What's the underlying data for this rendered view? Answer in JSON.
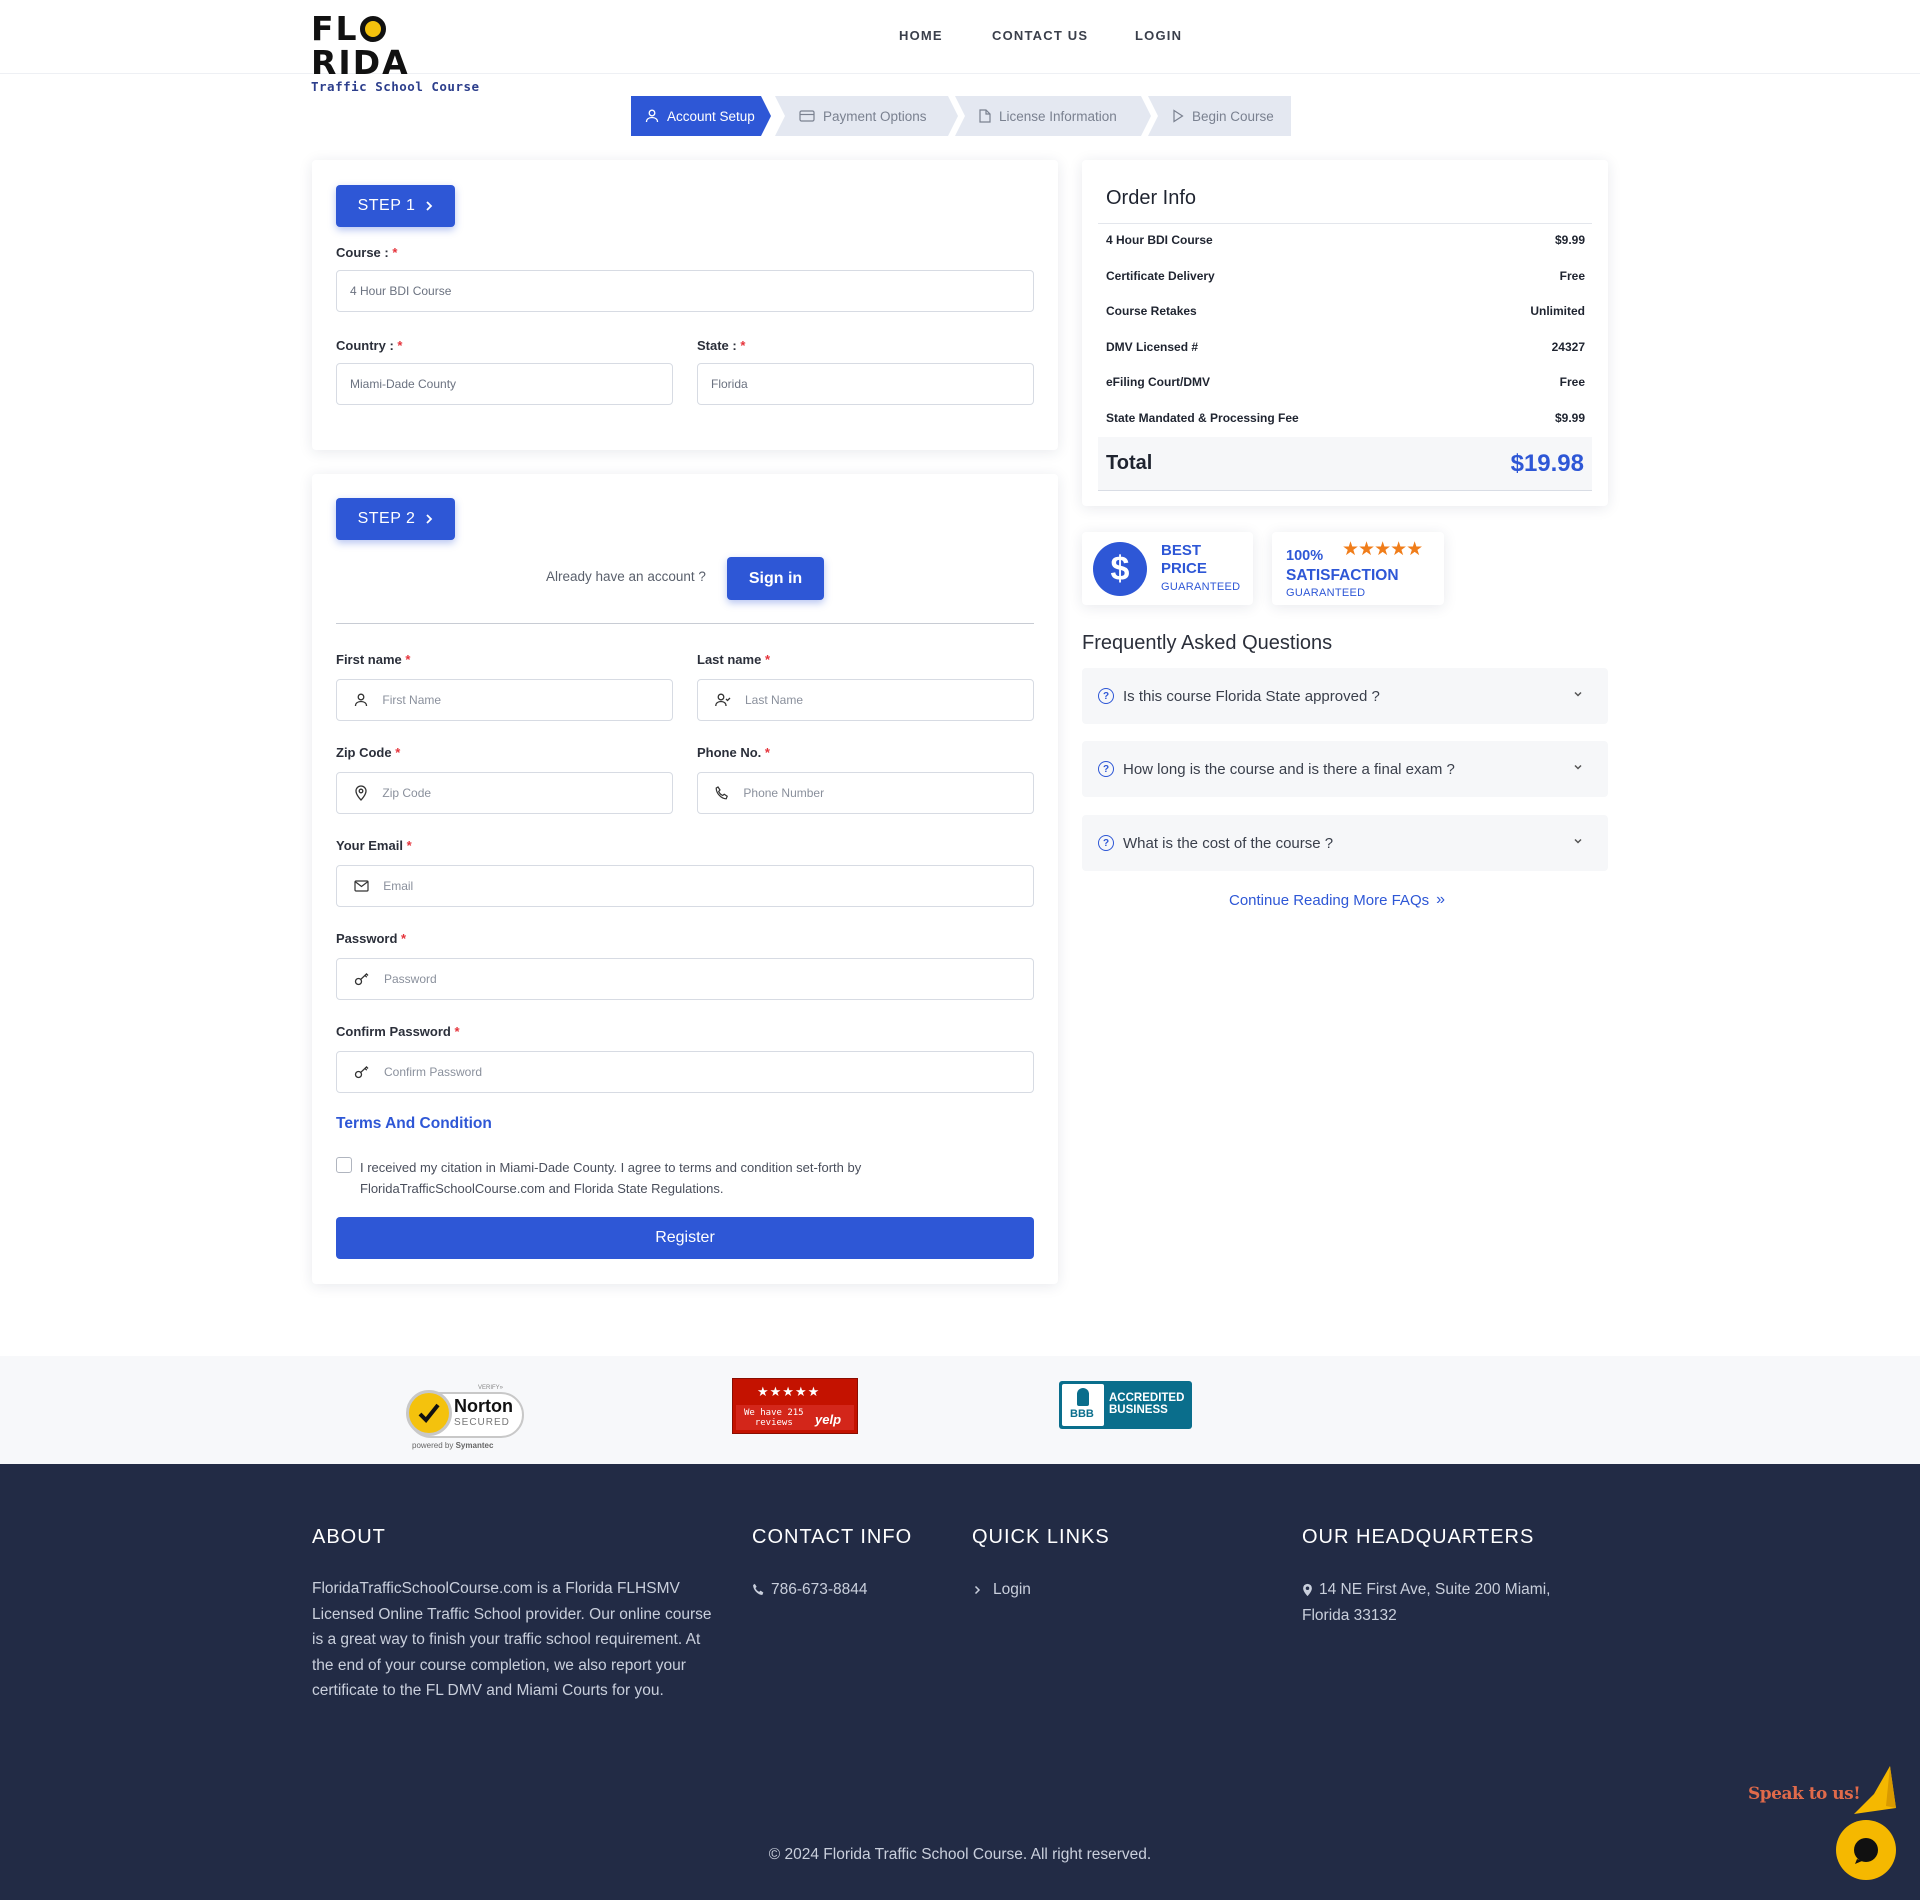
{
  "header": {
    "logo_top": "FLORIDA",
    "logo_sub": "Traffic School Course",
    "nav": [
      "HOME",
      "CONTACT US",
      "LOGIN"
    ]
  },
  "stepper": {
    "steps": [
      "Account Setup",
      "Payment Options",
      "License Information",
      "Begin Course"
    ],
    "active_index": 0
  },
  "step1": {
    "button": "STEP 1",
    "course_label": "Course :",
    "course_value": "4 Hour BDI Course",
    "country_label": "Country :",
    "country_value": "Miami-Dade County",
    "state_label": "State :",
    "state_value": "Florida"
  },
  "step2": {
    "button": "STEP 2",
    "already_text": "Already have an account ?",
    "signin_button": "Sign in",
    "first_name_label": "First name",
    "first_name_placeholder": "First Name",
    "last_name_label": "Last name",
    "last_name_placeholder": "Last Name",
    "zip_label": "Zip Code",
    "zip_placeholder": "Zip Code",
    "phone_label": "Phone No.",
    "phone_placeholder": "Phone Number",
    "email_label": "Your Email",
    "email_placeholder": "Email",
    "password_label": "Password",
    "password_placeholder": "Password",
    "confirm_label": "Confirm Password",
    "confirm_placeholder": "Confirm Password",
    "terms_title": "Terms And Condition",
    "terms_text_1": "I received my citation in Miami-Dade County. I agree to terms and condition set-forth by",
    "terms_text_2": "FloridaTrafficSchoolCourse.com and Florida State Regulations.",
    "register_button": "Register",
    "required_mark": "*"
  },
  "order_info": {
    "title": "Order Info",
    "rows": [
      {
        "label": "4 Hour BDI Course",
        "value": "$9.99"
      },
      {
        "label": "Certificate Delivery",
        "value": "Free"
      },
      {
        "label": "Course Retakes",
        "value": "Unlimited"
      },
      {
        "label": "DMV Licensed #",
        "value": "24327"
      },
      {
        "label": "eFiling Court/DMV",
        "value": "Free"
      },
      {
        "label": "State Mandated & Processing Fee",
        "value": "$9.99"
      }
    ],
    "total_label": "Total",
    "total_value": "$19.98"
  },
  "badges": {
    "best_line1": "BEST",
    "best_line2": "PRICE",
    "best_line3": "GUARANTEED",
    "sat_line1": "100%",
    "sat_line2": "SATISFACTION",
    "sat_line3": "GUARANTEED",
    "stars": 5
  },
  "faq": {
    "title": "Frequently Asked Questions",
    "items": [
      "Is this course Florida State approved ?",
      "How long is the course and is there a final exam ?",
      "What is the cost of the course ?"
    ],
    "more_link": "Continue Reading More FAQs"
  },
  "trust": {
    "norton_verify": "VERIFY»",
    "norton_name": "Norton",
    "norton_secured": "SECURED",
    "norton_powered": "powered by",
    "norton_symantec": "Symantec",
    "yelp_text_1": "We have 215",
    "yelp_text_2": "reviews",
    "yelp_logo": "yelp",
    "bbb_1": "ACCREDITED",
    "bbb_2": "BUSINESS",
    "bbb_logo": "BBB"
  },
  "footer": {
    "about_title": "ABOUT",
    "about_lines": [
      "FloridaTrafficSchoolCourse.com is a Florida FLHSMV",
      "Licensed Online Traffic School provider. Our online course",
      "is a great way to finish your traffic school requirement. At",
      "the end of your course completion, we also report your",
      "certificate to the FL DMV and Miami Courts for you."
    ],
    "contact_title": "CONTACT INFO",
    "phone": "786-673-8844",
    "links_title": "QUICK LINKS",
    "link_login": "Login",
    "hq_title": "OUR HEADQUARTERS",
    "hq_line1": "14 NE First Ave, Suite 200 Miami,",
    "hq_line2": "Florida 33132",
    "copyright": "© 2024 Florida Traffic School Course. All right reserved."
  },
  "chat": {
    "speak": "Speak to us!"
  },
  "colors": {
    "primary": "#2e57d6",
    "footer_bg": "#222b45",
    "required": "#e5333b",
    "star": "#f07d1a",
    "chat": "#f5b800"
  }
}
